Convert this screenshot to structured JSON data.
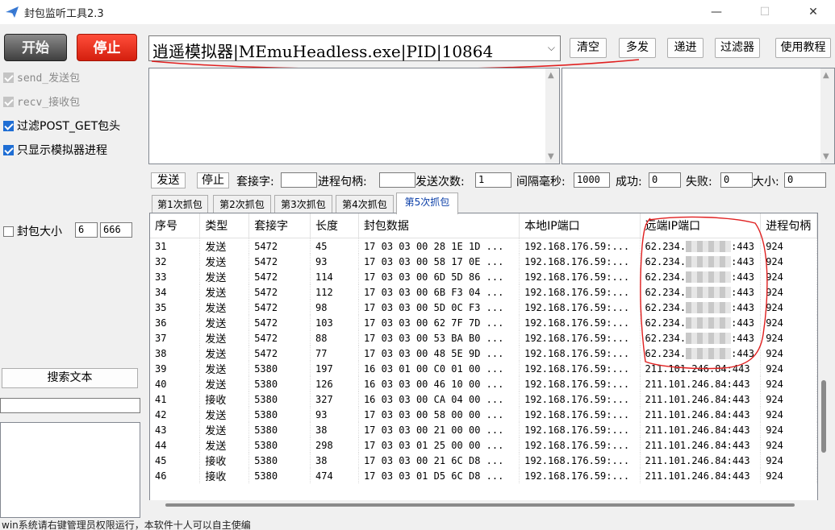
{
  "window": {
    "title": "封包监听工具2.3",
    "minimize": "—",
    "maximize": "☐",
    "close": "✕"
  },
  "top": {
    "start_label": "开始",
    "stop_label": "停止",
    "process_value": "逍遥模拟器|MEmuHeadless.exe|PID|10864",
    "buttons": [
      "清空",
      "多发",
      "递进",
      "过滤器",
      "使用教程"
    ]
  },
  "options": [
    {
      "label": "send_发送包",
      "checked": true,
      "disabled": true
    },
    {
      "label": "recv_接收包",
      "checked": true,
      "disabled": true
    },
    {
      "label": "过滤POST_GET包头",
      "checked": true,
      "disabled": false
    },
    {
      "label": "只显示模拟器进程",
      "checked": true,
      "disabled": false
    }
  ],
  "size_filter": {
    "label": "封包大小",
    "checked": false,
    "min": "6",
    "max": "666"
  },
  "controls": {
    "send_label": "发送",
    "stop_label": "停止",
    "socket_label": "套接字:",
    "socket_value": "",
    "handle_label": "进程句柄:",
    "handle_value": "",
    "count_label": "发送次数:",
    "count_value": "1",
    "interval_label": "间隔毫秒:",
    "interval_value": "1000",
    "success_label": "成功:",
    "success_value": "0",
    "fail_label": "失败:",
    "fail_value": "0",
    "size_label": "大小:",
    "size_value": "0"
  },
  "tabs": [
    "第1次抓包",
    "第2次抓包",
    "第3次抓包",
    "第4次抓包",
    "第5次抓包"
  ],
  "active_tab": 4,
  "table": {
    "headers": [
      "序号",
      "类型",
      "套接字",
      "长度",
      "封包数据",
      "本地IP端口",
      "远端IP端口",
      "进程句柄"
    ],
    "rows": [
      [
        "31",
        "发送",
        "5472",
        "45",
        "17 03 03 00 28 1E 1D ...",
        "192.168.176.59:...",
        "62.234.",
        "443",
        "924"
      ],
      [
        "32",
        "发送",
        "5472",
        "93",
        "17 03 03 00 58 17 0E ...",
        "192.168.176.59:...",
        "62.234.",
        "443",
        "924"
      ],
      [
        "33",
        "发送",
        "5472",
        "114",
        "17 03 03 00 6D 5D 86 ...",
        "192.168.176.59:...",
        "62.234.",
        "443",
        "924"
      ],
      [
        "34",
        "发送",
        "5472",
        "112",
        "17 03 03 00 6B F3 04 ...",
        "192.168.176.59:...",
        "62.234.",
        "443",
        "924"
      ],
      [
        "35",
        "发送",
        "5472",
        "98",
        "17 03 03 00 5D 0C F3 ...",
        "192.168.176.59:...",
        "62.234.",
        "443",
        "924"
      ],
      [
        "36",
        "发送",
        "5472",
        "103",
        "17 03 03 00 62 7F 7D ...",
        "192.168.176.59:...",
        "62.234.",
        "443",
        "924"
      ],
      [
        "37",
        "发送",
        "5472",
        "88",
        "17 03 03 00 53 BA B0 ...",
        "192.168.176.59:...",
        "62.234.",
        "443",
        "924"
      ],
      [
        "38",
        "发送",
        "5472",
        "77",
        "17 03 03 00 48 5E 9D ...",
        "192.168.176.59:...",
        "62.234.",
        "443",
        "924"
      ],
      [
        "39",
        "发送",
        "5380",
        "197",
        "16 03 01 00 C0 01 00 ...",
        "192.168.176.59:...",
        "211.101.246.84:443",
        "",
        "924"
      ],
      [
        "40",
        "发送",
        "5380",
        "126",
        "16 03 03 00 46 10 00 ...",
        "192.168.176.59:...",
        "211.101.246.84:443",
        "",
        "924"
      ],
      [
        "41",
        "接收",
        "5380",
        "327",
        "16 03 03 00 CA 04 00 ...",
        "192.168.176.59:...",
        "211.101.246.84:443",
        "",
        "924"
      ],
      [
        "42",
        "发送",
        "5380",
        "93",
        "17 03 03 00 58 00 00 ...",
        "192.168.176.59:...",
        "211.101.246.84:443",
        "",
        "924"
      ],
      [
        "43",
        "发送",
        "5380",
        "38",
        "17 03 03 00 21 00 00 ...",
        "192.168.176.59:...",
        "211.101.246.84:443",
        "",
        "924"
      ],
      [
        "44",
        "发送",
        "5380",
        "298",
        "17 03 03 01 25 00 00 ...",
        "192.168.176.59:...",
        "211.101.246.84:443",
        "",
        "924"
      ],
      [
        "45",
        "接收",
        "5380",
        "38",
        "17 03 03 00 21 6C D8 ...",
        "192.168.176.59:...",
        "211.101.246.84:443",
        "",
        "924"
      ],
      [
        "46",
        "接收",
        "5380",
        "474",
        "17 03 03 01 D5 6C D8 ...",
        "192.168.176.59:...",
        "211.101.246.84:443",
        "",
        "924"
      ]
    ]
  },
  "left": {
    "search_label": "搜索文本"
  },
  "status": "win系统请右键管理员权限运行，本软件十人可以自主使编"
}
